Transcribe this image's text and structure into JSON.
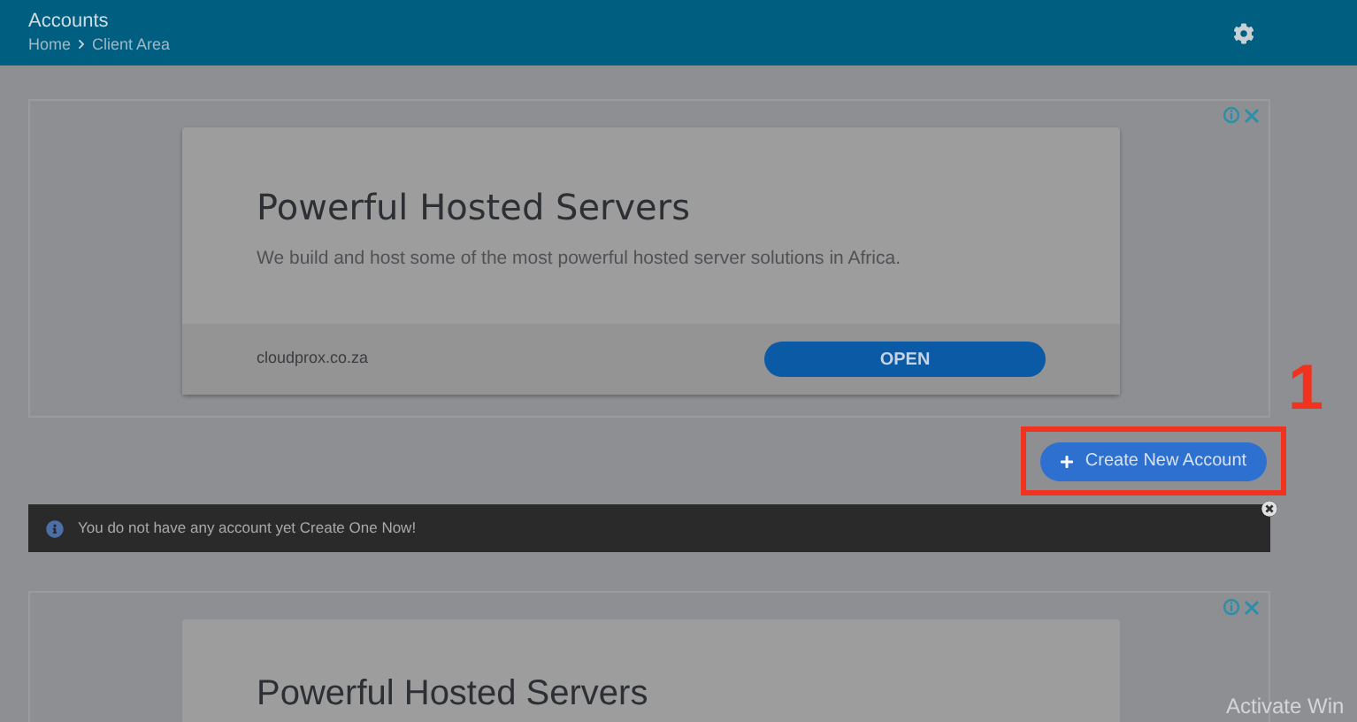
{
  "header": {
    "title": "Accounts",
    "breadcrumb": [
      "Home",
      "Client Area"
    ]
  },
  "ads": [
    {
      "title": "Powerful Hosted Servers",
      "body": "We build and host some of the most powerful hosted server solutions in Africa.",
      "domain": "cloudprox.co.za",
      "button": "OPEN"
    },
    {
      "title": "Powerful Hosted Servers"
    }
  ],
  "annotation": {
    "number": "1"
  },
  "create_button": {
    "label": "Create New Account"
  },
  "alert": {
    "message": "You do not have any account yet Create One Now!"
  },
  "overlay_text": "Activate Win"
}
